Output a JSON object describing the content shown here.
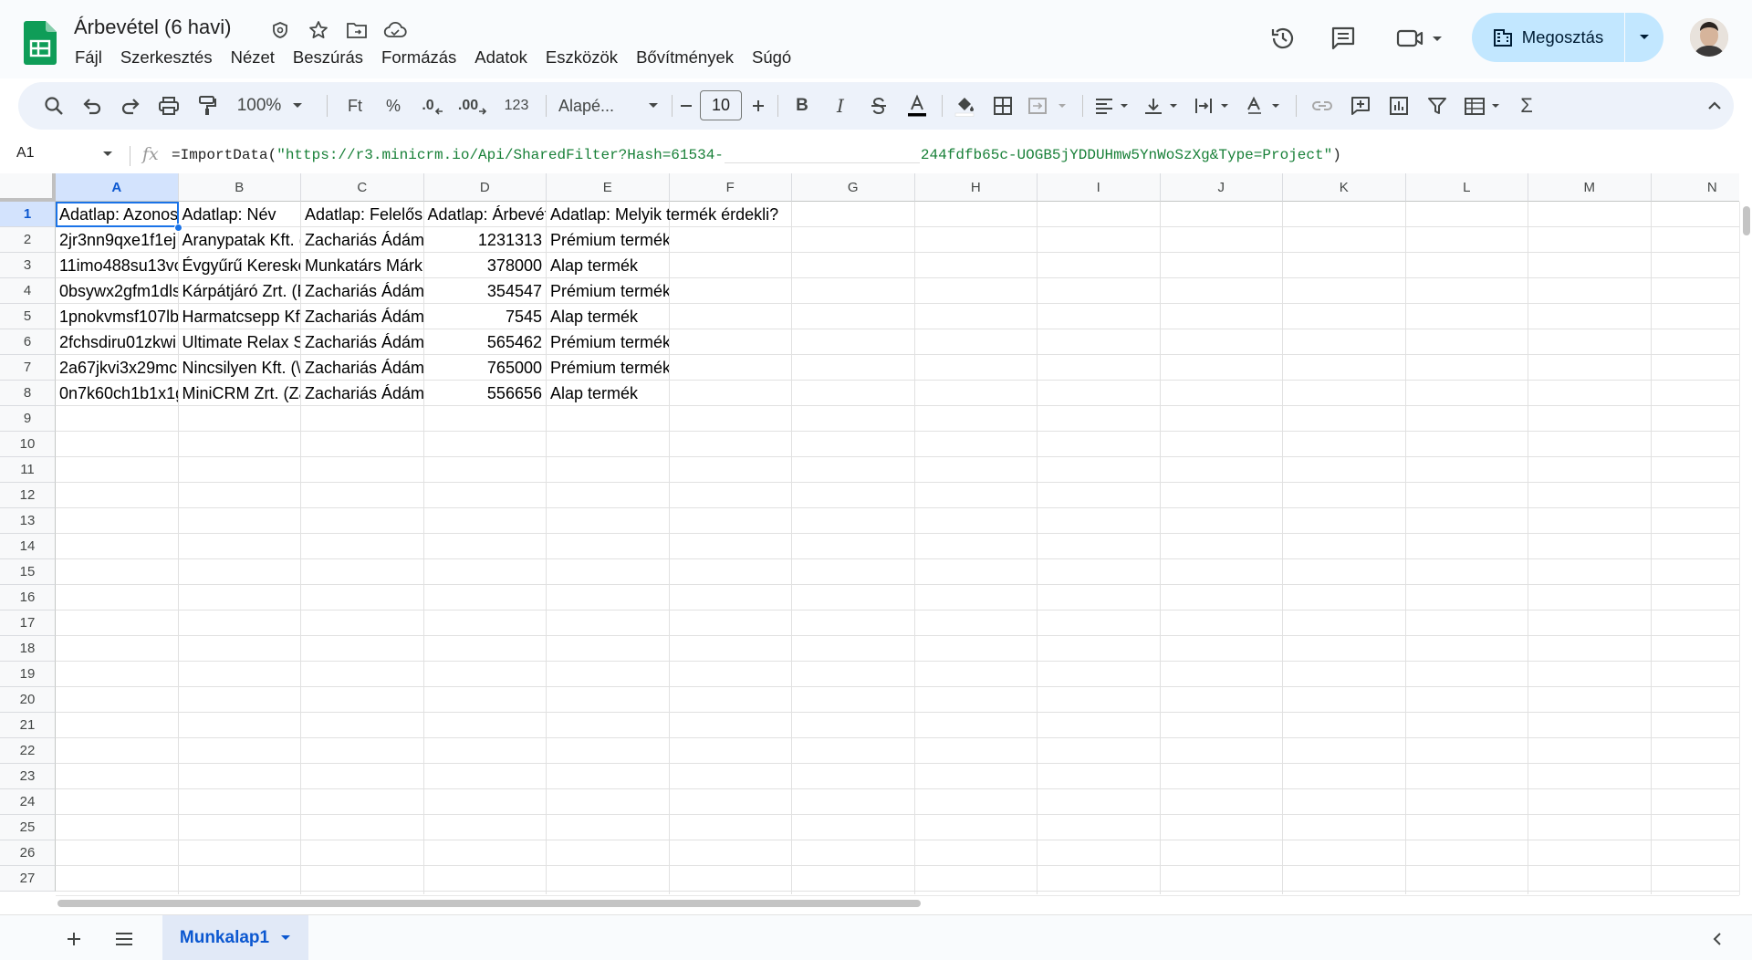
{
  "app": {
    "doc_title": "Árbevétel (6 havi)",
    "menu": [
      "Fájl",
      "Szerkesztés",
      "Nézet",
      "Beszúrás",
      "Formázás",
      "Adatok",
      "Eszközök",
      "Bővítmények",
      "Súgó"
    ],
    "share_label": "Megosztás"
  },
  "toolbar": {
    "zoom": "100%",
    "currency": "Ft",
    "percent": "%",
    "dec_less": ".0",
    "dec_more": ".00",
    "number_format": "123",
    "font": "Alapé...",
    "font_size": "10"
  },
  "formula_bar": {
    "cell_ref": "A1",
    "formula_prefix": "=ImportData(",
    "formula_str1": "\"https://r3.minicrm.io/Api/SharedFilter?Hash=61534-",
    "formula_str2": "244fdfb65c-UOGB5jYDDUHmw5YnWoSzXg&Type=Project\"",
    "formula_suffix": ")"
  },
  "grid": {
    "columns": [
      "A",
      "B",
      "C",
      "D",
      "E",
      "F",
      "G",
      "H",
      "I",
      "J",
      "K",
      "L",
      "M",
      "N"
    ],
    "rows": [
      "1",
      "2",
      "3",
      "4",
      "5",
      "6",
      "7",
      "8",
      "9",
      "10",
      "11",
      "12",
      "13",
      "14",
      "15",
      "16",
      "17",
      "18",
      "19",
      "20",
      "21",
      "22",
      "23",
      "24",
      "25",
      "26",
      "27"
    ],
    "data": [
      [
        "Adatlap: Azonos",
        "Adatlap: Név",
        "Adatlap: Felelős",
        "Adatlap: Árbevét",
        "Adatlap: Melyik termék érdekli?"
      ],
      [
        "2jr3nn9qxe1f1ej",
        "Aranypatak Kft. (",
        "Zachariás Ádám",
        "1231313",
        "Prémium termék"
      ],
      [
        "11imo488su13vc",
        "Évgyűrű Kereske",
        "Munkatárs Márk",
        "378000",
        "Alap termék"
      ],
      [
        "0bsywx2gfm1dls",
        "Kárpátjáró Zrt. (E",
        "Zachariás Ádám",
        "354547",
        "Prémium termék"
      ],
      [
        "1pnokvmsf107lb",
        "Harmatcsepp Kft",
        "Zachariás Ádám",
        "7545",
        "Alap termék"
      ],
      [
        "2fchsdiru01zkwi",
        "Ultimate Relax S",
        "Zachariás Ádám",
        "565462",
        "Prémium termék"
      ],
      [
        "2a67jkvi3x29mc",
        "Nincsilyen Kft. (\\",
        "Zachariás Ádám",
        "765000",
        "Prémium termék"
      ],
      [
        "0n7k60ch1b1x1g",
        "MiniCRM Zrt. (Za",
        "Zachariás Ádám",
        "556656",
        "Alap termék"
      ]
    ]
  },
  "sheets": {
    "active": "Munkalap1"
  },
  "colors": {
    "accent": "#1a73e8",
    "share_bg": "#c2e7ff",
    "sheets_green": "#0f9d58",
    "formula_string": "#188038"
  }
}
